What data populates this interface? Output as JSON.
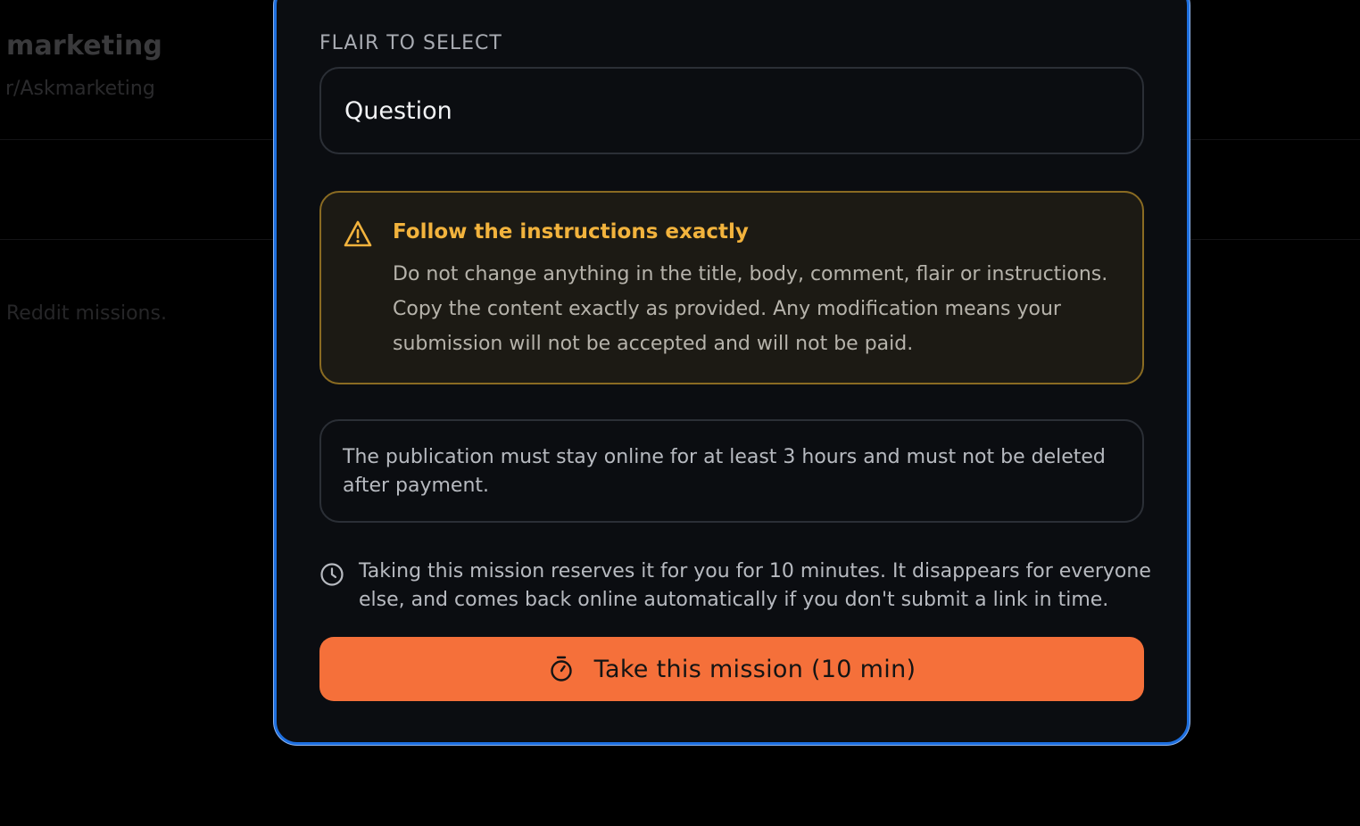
{
  "background": {
    "title": "marketing",
    "subreddit": "r/Askmarketing",
    "description": "Reddit missions."
  },
  "modal": {
    "flair_label": "FLAIR TO SELECT",
    "flair_value": "Question",
    "warning": {
      "title": "Follow the instructions exactly",
      "body": "Do not change anything in the title, body, comment, flair or instructions. Copy the content exactly as provided. Any modification means your submission will not be accepted and will not be paid.",
      "icon": "warning-triangle-icon",
      "color": "#f2b33d"
    },
    "retention_notice": "The publication must stay online for at least 3 hours and must not be deleted after payment.",
    "reservation_notice": "Taking this mission reserves it for you for 10 minutes. It disappears for everyone else, and comes back online automatically if you don't submit a link in time.",
    "take_button": {
      "label": "Take this mission (10 min)",
      "icon": "stopwatch-icon",
      "color": "#f5703a"
    },
    "accent_color": "#1d6fe0"
  }
}
